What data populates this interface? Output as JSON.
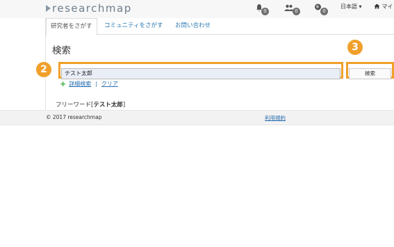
{
  "header": {
    "logo_text": "researchmap",
    "notifications": [
      {
        "icon": "bell-icon",
        "count": "0"
      },
      {
        "icon": "users-icon",
        "count": "0"
      },
      {
        "icon": "globe-icon",
        "count": "0"
      }
    ],
    "language_label": "日本語 ▾",
    "mypage_label": "マイ"
  },
  "tabs": [
    {
      "label": "研究者をさがす",
      "active": true
    },
    {
      "label": "コミュニティをさがす",
      "active": false
    },
    {
      "label": "お問い合わせ",
      "active": false
    }
  ],
  "page_title": "検索",
  "search": {
    "value": "テスト太郎",
    "button_label": "検索"
  },
  "markers": {
    "input_marker": "2",
    "button_marker": "3"
  },
  "links": {
    "advanced": "詳細検索",
    "separator": "|",
    "clear": "クリア"
  },
  "freeword": {
    "prefix": "フリーワード[",
    "term": "テスト太郎",
    "suffix": "]"
  },
  "footer": {
    "copyright": "© 2017 researchmap",
    "terms": "利用規約"
  },
  "colors": {
    "highlight": "#f0a02a",
    "link": "#2a6fb0"
  }
}
